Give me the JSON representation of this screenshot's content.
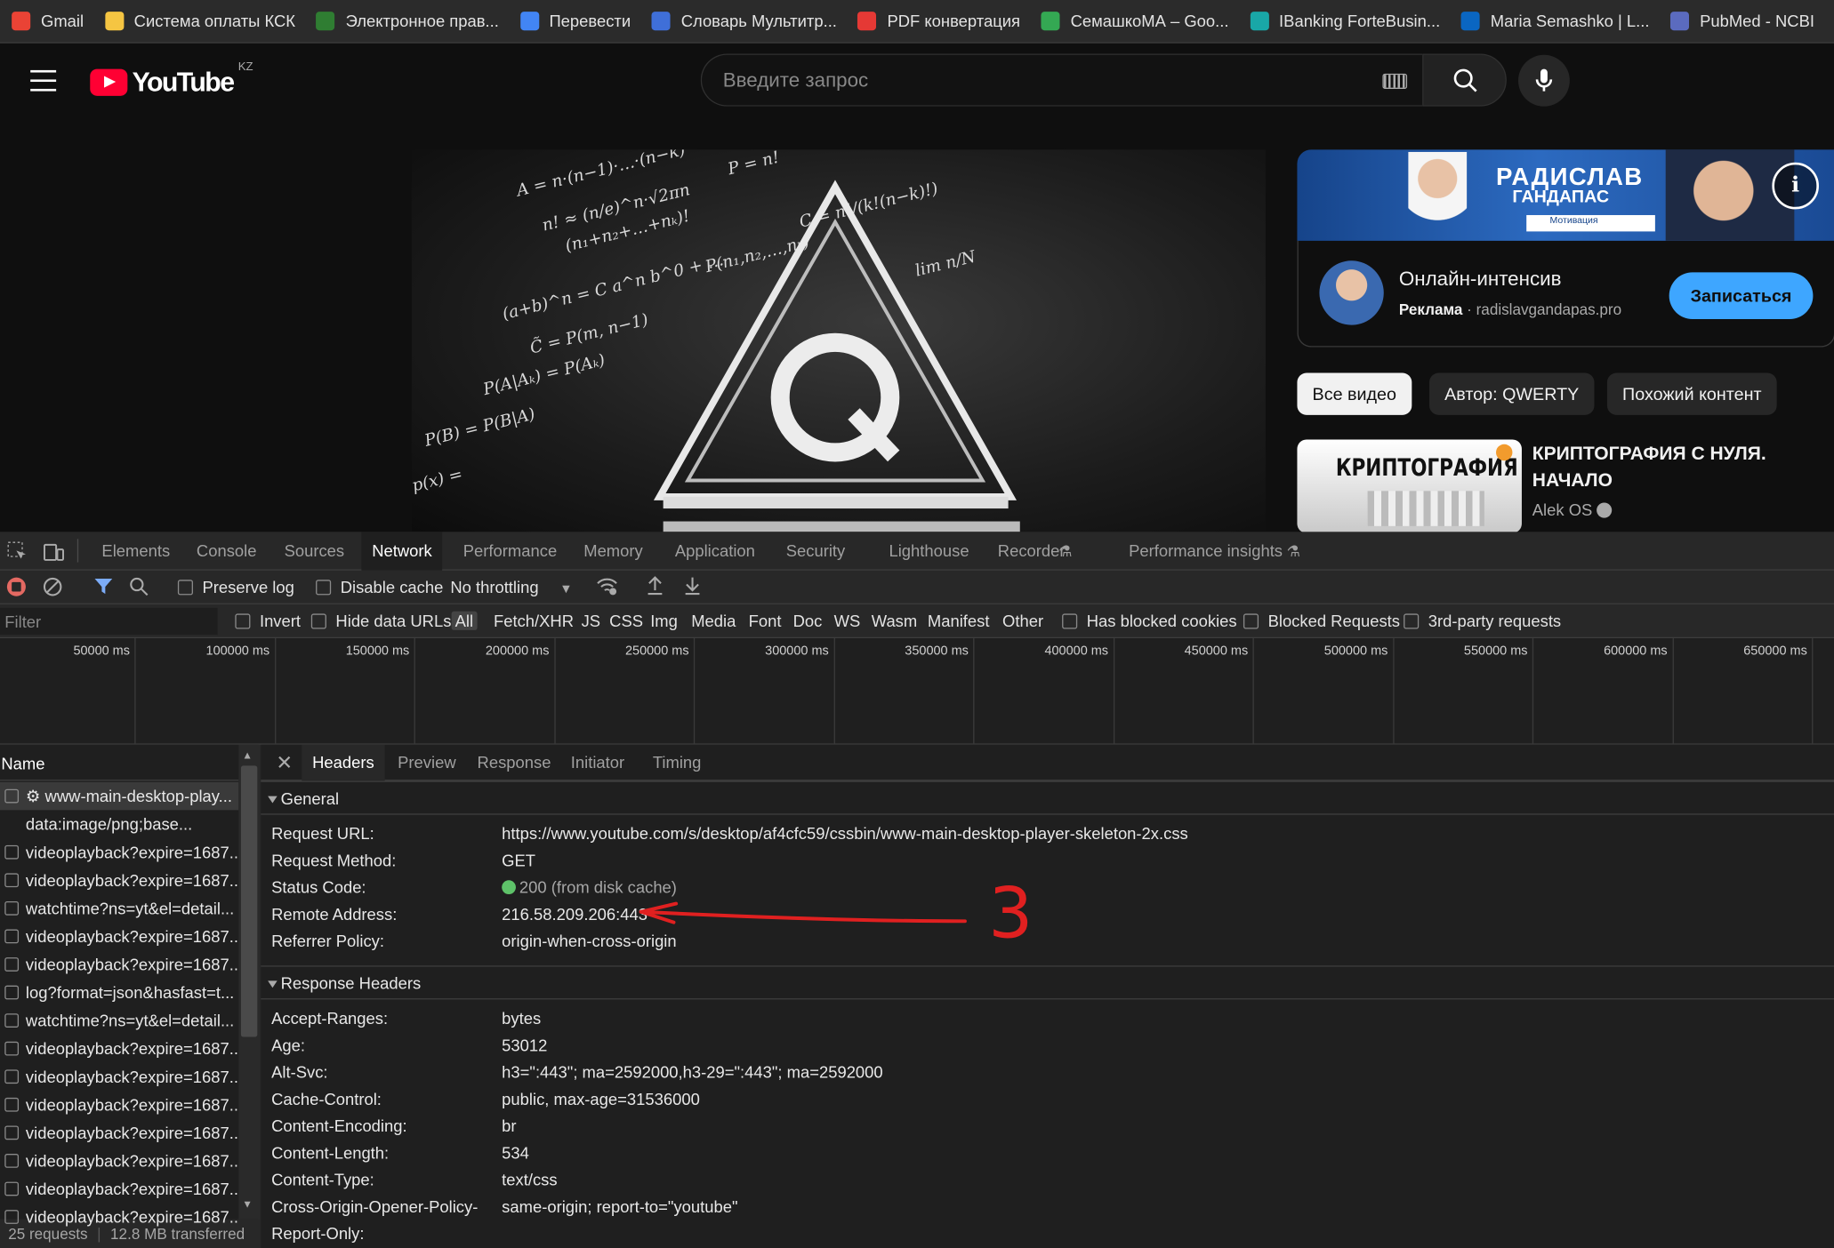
{
  "bookmarks": [
    "Gmail",
    "Система оплаты КСК",
    "Электронное прав...",
    "Перевести",
    "Словарь Мультитр...",
    "PDF конвертация",
    "СемашкоМА – Goo...",
    "IBanking ForteBusin...",
    "Maria Semashko | L...",
    "PubMed - NCBI"
  ],
  "bookmark_colors": [
    "#ea4335",
    "#f5c542",
    "#2f7d32",
    "#4285f4",
    "#3f6fd8",
    "#e53935",
    "#34a853",
    "#19a7a7",
    "#0a66c2",
    "#5b6bbf"
  ],
  "youtube": {
    "logo_text": "YouTube",
    "country": "KZ",
    "search_placeholder": "Введите запрос"
  },
  "ad": {
    "banner_line1": "РАДИСЛАВ",
    "banner_line2": "ГАНДАПАС",
    "banner_small": "Мотивация",
    "title": "Онлайн-интенсив",
    "label": "Реклама",
    "domain": "radislavgandapas.pro",
    "cta": "Записаться"
  },
  "chips": [
    "Все видео",
    "Автор: QWERTY",
    "Похожий контент"
  ],
  "related": {
    "thumb_text": "КРИПТОГРАФИЯ",
    "title": "КРИПТОГРАФИЯ С НУЛЯ. НАЧАЛО",
    "channel": "Alek OS"
  },
  "video_formulas": [
    "A = n·(n−1)·…·(n−k)",
    "P = n!",
    "n! ≈ (n/e)^n·√2πn",
    "(n₁+n₂+…+nₖ)!",
    "C = n!/(k!(n−k)!)",
    "P(n₁,n₂,…,nₖ)",
    "(a+b)^n = C a^n b^0 + …",
    "lim n/N",
    "C̃ = P(m, n−1)",
    "P(A|Aₖ) = P(Aₖ)",
    "P(B) = P(B|A)",
    "p(x) ="
  ],
  "devtools": {
    "tabs": [
      "Elements",
      "Console",
      "Sources",
      "Network",
      "Performance",
      "Memory",
      "Application",
      "Security",
      "Lighthouse",
      "Recorder",
      "Performance insights"
    ],
    "preserve_log": "Preserve log",
    "disable_cache": "Disable cache",
    "throttling": "No throttling",
    "filter_placeholder": "Filter",
    "filters": [
      "Invert",
      "Hide data URLs",
      "All",
      "Fetch/XHR",
      "JS",
      "CSS",
      "Img",
      "Media",
      "Font",
      "Doc",
      "WS",
      "Wasm",
      "Manifest",
      "Other",
      "Has blocked cookies",
      "Blocked Requests",
      "3rd-party requests"
    ],
    "timeline": [
      "50000 ms",
      "100000 ms",
      "150000 ms",
      "200000 ms",
      "250000 ms",
      "300000 ms",
      "350000 ms",
      "400000 ms",
      "450000 ms",
      "500000 ms",
      "550000 ms",
      "600000 ms",
      "650000 ms"
    ],
    "name_header": "Name",
    "requests": [
      "⚙ www-main-desktop-play...",
      "data:image/png;base...",
      "videoplayback?expire=1687...",
      "videoplayback?expire=1687...",
      "watchtime?ns=yt&el=detail...",
      "videoplayback?expire=1687...",
      "videoplayback?expire=1687...",
      "log?format=json&hasfast=t...",
      "watchtime?ns=yt&el=detail...",
      "videoplayback?expire=1687...",
      "videoplayback?expire=1687...",
      "videoplayback?expire=1687...",
      "videoplayback?expire=1687...",
      "videoplayback?expire=1687...",
      "videoplayback?expire=1687...",
      "videoplayback?expire=1687..."
    ],
    "status_requests": "25 requests",
    "status_transferred": "12.8 MB transferred",
    "detail_tabs": [
      "Headers",
      "Preview",
      "Response",
      "Initiator",
      "Timing"
    ],
    "general_title": "General",
    "general": [
      [
        "Request URL:",
        "https://www.youtube.com/s/desktop/af4cfc59/cssbin/www-main-desktop-player-skeleton-2x.css"
      ],
      [
        "Request Method:",
        "GET"
      ],
      [
        "Status Code:",
        "200 (from disk cache)"
      ],
      [
        "Remote Address:",
        "216.58.209.206:443"
      ],
      [
        "Referrer Policy:",
        "origin-when-cross-origin"
      ]
    ],
    "response_title": "Response Headers",
    "response": [
      [
        "Accept-Ranges:",
        "bytes"
      ],
      [
        "Age:",
        "53012"
      ],
      [
        "Alt-Svc:",
        "h3=\":443\"; ma=2592000,h3-29=\":443\"; ma=2592000"
      ],
      [
        "Cache-Control:",
        "public, max-age=31536000"
      ],
      [
        "Content-Encoding:",
        "br"
      ],
      [
        "Content-Length:",
        "534"
      ],
      [
        "Content-Type:",
        "text/css"
      ],
      [
        "Cross-Origin-Opener-Policy-",
        "same-origin; report-to=\"youtube\""
      ],
      [
        "Report-Only:",
        ""
      ]
    ]
  },
  "annotation": {
    "number": "3",
    "color": "#e02020"
  }
}
